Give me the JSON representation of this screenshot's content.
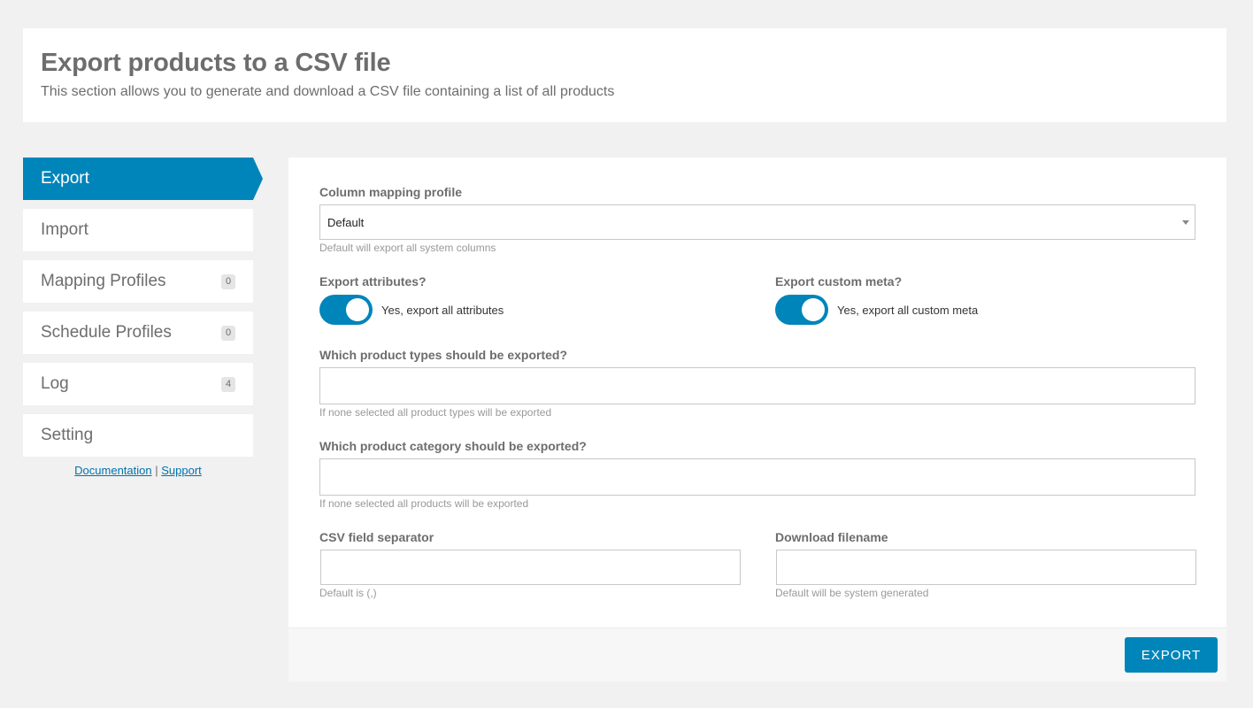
{
  "header": {
    "title": "Export products to a CSV file",
    "subtitle": "This section allows you to generate and download a CSV file containing a list of all products"
  },
  "sidebar": {
    "items": [
      {
        "label": "Export",
        "active": true
      },
      {
        "label": "Import"
      },
      {
        "label": "Mapping Profiles",
        "badge": "0"
      },
      {
        "label": "Schedule Profiles",
        "badge": "0"
      },
      {
        "label": "Log",
        "badge": "4"
      },
      {
        "label": "Setting"
      }
    ],
    "links": {
      "documentation": "Documentation",
      "separator": "|",
      "support": "Support"
    }
  },
  "form": {
    "mapping_profile": {
      "label": "Column mapping profile",
      "value": "Default",
      "hint": "Default will export all system columns"
    },
    "export_attributes": {
      "label": "Export attributes?",
      "toggle_text": "Yes, export all attributes",
      "on": true
    },
    "export_meta": {
      "label": "Export custom meta?",
      "toggle_text": "Yes, export all custom meta",
      "on": true
    },
    "product_types": {
      "label": "Which product types should be exported?",
      "value": "",
      "hint": "If none selected all product types will be exported"
    },
    "product_category": {
      "label": "Which product category should be exported?",
      "value": "",
      "hint": "If none selected all products will be exported"
    },
    "separator": {
      "label": "CSV field separator",
      "value": "",
      "hint": "Default is (,)"
    },
    "filename": {
      "label": "Download filename",
      "value": "",
      "hint": "Default will be system generated"
    }
  },
  "footer": {
    "export_label": "EXPORT"
  },
  "colors": {
    "accent": "#0085ba",
    "background": "#f1f1f1"
  }
}
